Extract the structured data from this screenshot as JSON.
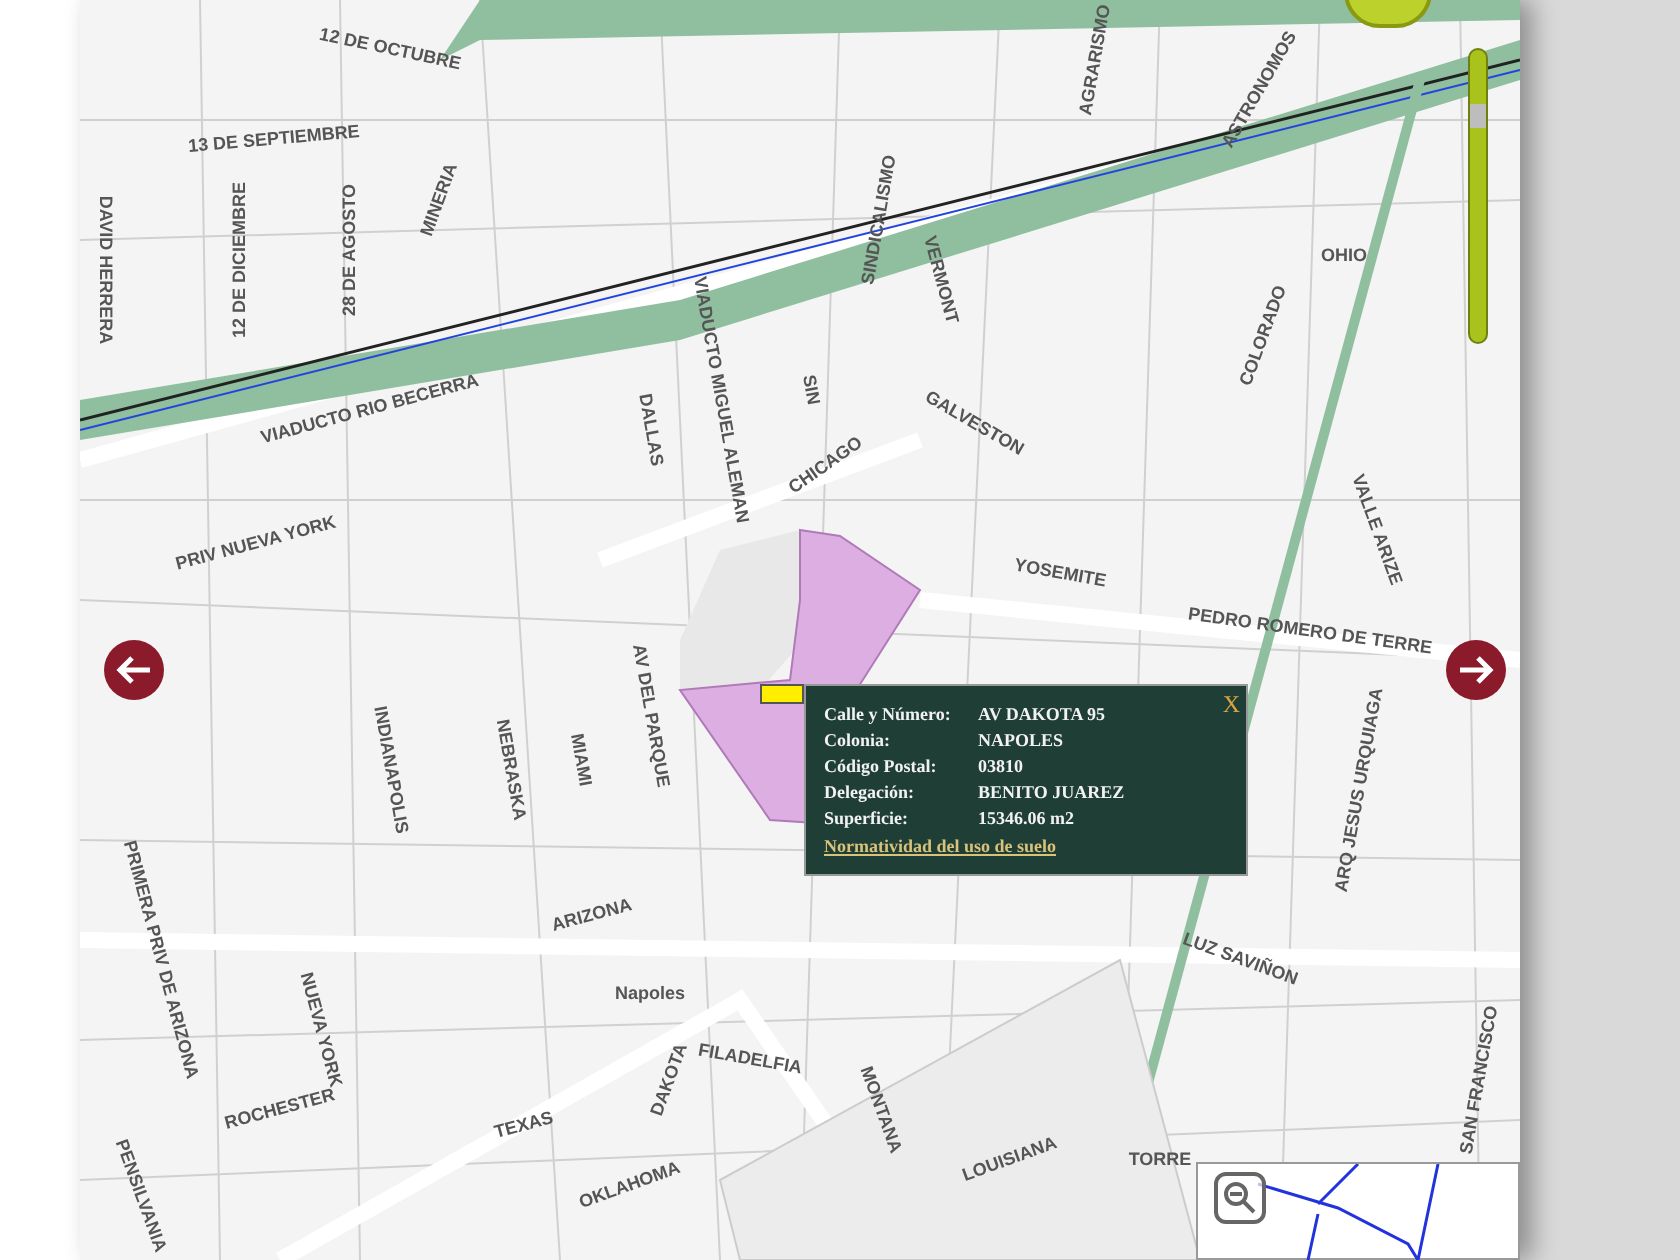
{
  "map": {
    "street_labels": [
      "12 DE OCTUBRE",
      "13 DE SEPTIEMBRE",
      "DAVID HERRERA",
      "12 DE DICIEMBRE",
      "28 DE AGOSTO",
      "MINERIA",
      "VIADUCTO RIO BECERRA",
      "VIADUCTO MIGUEL ALEMAN",
      "SINDICALISMO",
      "VERMONT",
      "AGRARISMO",
      "ASTRONOMOS",
      "OHIO",
      "COLORADO",
      "SIN",
      "GALVESTON",
      "CHICAGO",
      "DALLAS",
      "PRIV NUEVA YORK",
      "YOSEMITE",
      "PEDRO ROMERO DE TERRE",
      "VALLE ARIZE",
      "AV DEL PARQUE",
      "INDIANAPOLIS",
      "NEBRASKA",
      "MIAMI",
      "ARQ JESUS URQUIAGA",
      "ARIZONA",
      "Napoles",
      "PRIMERA PRIV DE ARIZONA",
      "NUEVA YORK",
      "ROCHESTER",
      "DAKOTA",
      "FILADELFIA",
      "MONTANA",
      "TEXAS",
      "OKLAHOMA",
      "LOUISIANA",
      "LUZ SAVIÑON",
      "SAN FRANCISCO",
      "PENSILVANIA",
      "TORRE"
    ]
  },
  "popup": {
    "close": "X",
    "fields": [
      {
        "label": "Calle y Número:",
        "value": "AV DAKOTA 95"
      },
      {
        "label": "Colonia:",
        "value": "NAPOLES"
      },
      {
        "label": "Código Postal:",
        "value": "03810"
      },
      {
        "label": "Delegación:",
        "value": "BENITO JUAREZ"
      },
      {
        "label": "Superficie:",
        "value": "15346.06 m2"
      }
    ],
    "link": "Normatividad del uso de suelo"
  },
  "zoom": {
    "level": 0.8
  }
}
